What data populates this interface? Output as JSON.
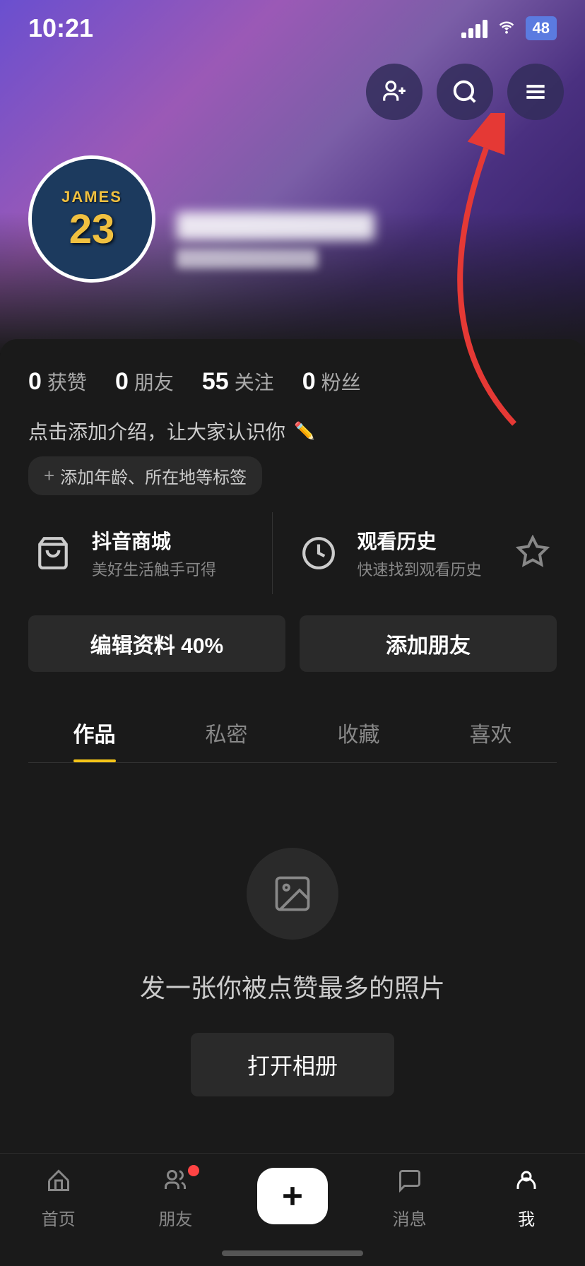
{
  "status": {
    "time": "10:21",
    "battery": "48"
  },
  "header": {
    "follow_btn_label": "关注",
    "search_btn_label": "搜索",
    "menu_btn_label": "菜单"
  },
  "profile": {
    "avatar_name": "JAMES 23",
    "jersey_name": "JAMES",
    "jersey_number": "23",
    "blurred_name": "",
    "blurred_id": ""
  },
  "stats": [
    {
      "num": "0",
      "label": "获赞"
    },
    {
      "num": "0",
      "label": "朋友"
    },
    {
      "num": "55",
      "label": "关注"
    },
    {
      "num": "0",
      "label": "粉丝"
    }
  ],
  "bio": {
    "text": "点击添加介绍，让大家认识你",
    "tag_label": "添加年龄、所在地等标签"
  },
  "quick_links": [
    {
      "icon": "cart",
      "title": "抖音商城",
      "subtitle": "美好生活触手可得"
    },
    {
      "icon": "clock",
      "title": "观看历史",
      "subtitle": "快速找到观看历史"
    }
  ],
  "buttons": {
    "edit_profile": "编辑资料 40%",
    "add_friend": "添加朋友"
  },
  "tabs": [
    {
      "label": "作品",
      "active": true
    },
    {
      "label": "私密",
      "active": false
    },
    {
      "label": "收藏",
      "active": false
    },
    {
      "label": "喜欢",
      "active": false
    }
  ],
  "empty_state": {
    "text": "发一张你被点赞最多的照片",
    "button": "打开相册"
  },
  "bottom_nav": [
    {
      "label": "首页",
      "active": false,
      "has_dot": false
    },
    {
      "label": "朋友",
      "active": false,
      "has_dot": true
    },
    {
      "label": "",
      "active": false,
      "has_dot": false,
      "is_plus": true
    },
    {
      "label": "消息",
      "active": false,
      "has_dot": false
    },
    {
      "label": "我",
      "active": true,
      "has_dot": false
    }
  ]
}
